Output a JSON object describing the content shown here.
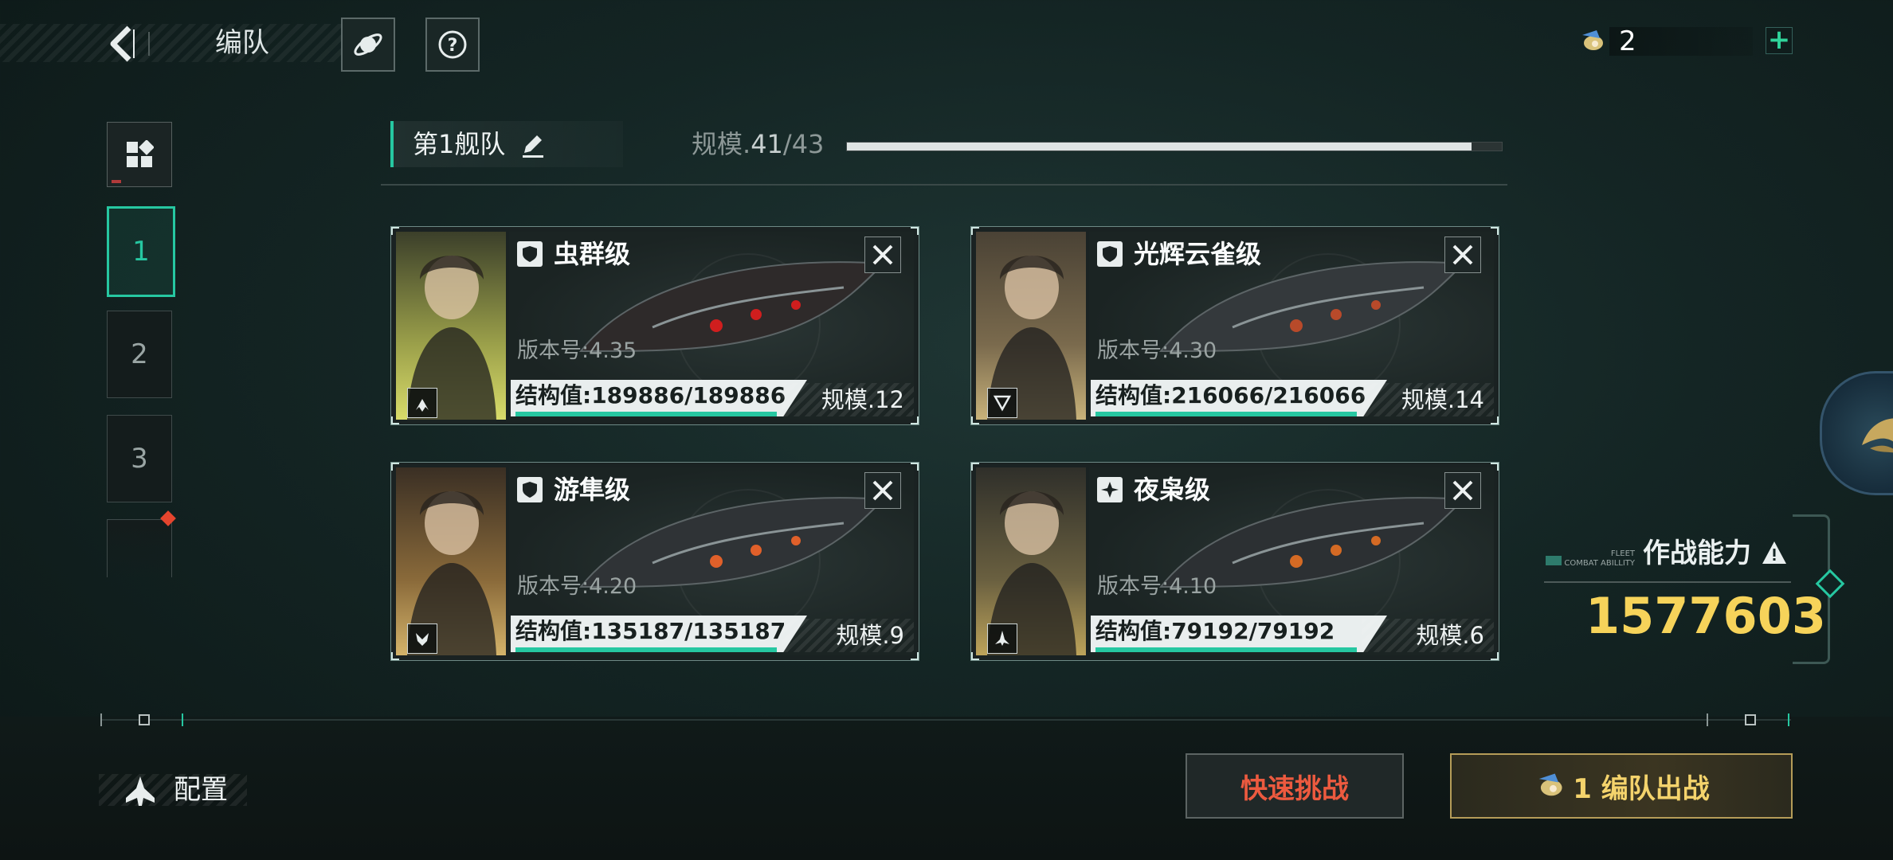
{
  "header": {
    "title": "编队",
    "currency_value": "2"
  },
  "tabs": [
    "1",
    "2",
    "3"
  ],
  "fleet": {
    "name": "第1舰队",
    "scale_prefix": "规模.",
    "scale_current": "41",
    "scale_max": "/43",
    "scale_fraction": 0.9535
  },
  "ships": [
    {
      "class_name": "虫群级",
      "version": "版本号:4.35",
      "structure": "结构值:189886/189886",
      "scale": "规模.12",
      "structure_fraction": 1.0
    },
    {
      "class_name": "光辉云雀级",
      "version": "版本号:4.30",
      "structure": "结构值:216066/216066",
      "scale": "规模.14",
      "structure_fraction": 1.0
    },
    {
      "class_name": "游隼级",
      "version": "版本号:4.20",
      "structure": "结构值:135187/135187",
      "scale": "规模.9",
      "structure_fraction": 1.0
    },
    {
      "class_name": "夜枭级",
      "version": "版本号:4.10",
      "structure": "结构值:79192/79192",
      "scale": "规模.6",
      "structure_fraction": 1.0
    }
  ],
  "combat": {
    "en_line1": "FLEET",
    "en_line2": "COMBAT ABILLITY",
    "label": "作战能力",
    "value": "1577603"
  },
  "bottom": {
    "config_label": "配置",
    "quick_challenge_label": "快速挑战",
    "deploy_label": "1 编队出战"
  },
  "colors": {
    "accent": "#26c7a1",
    "gold": "#f6d35a",
    "danger": "#ec5a3f"
  }
}
